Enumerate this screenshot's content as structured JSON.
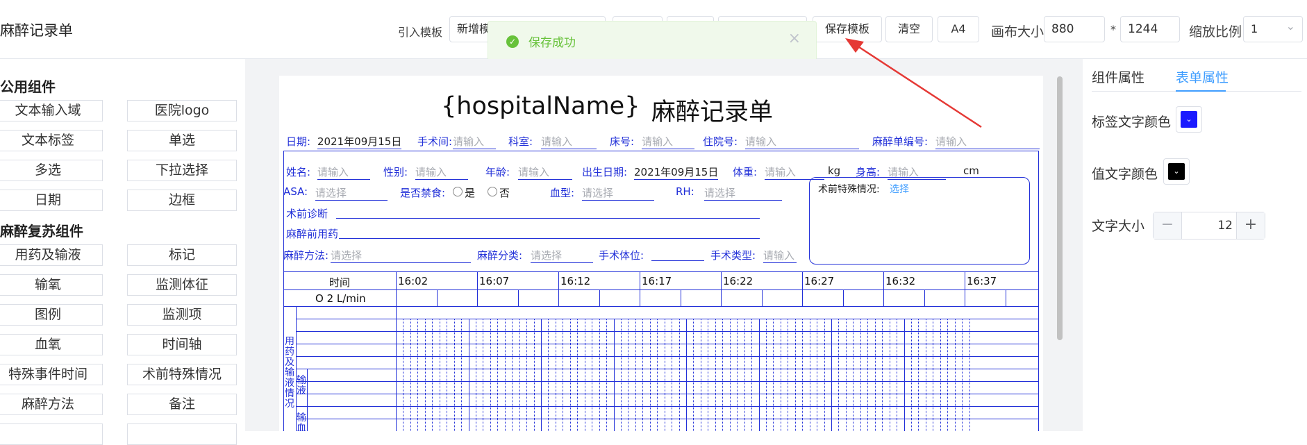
{
  "header": {
    "app_title": "麻醉记录单",
    "import_template_label": "引入模板",
    "template_select_value": "新增模",
    "save_template_label": "保存模板",
    "clear_label": "清空",
    "paper_size_label": "A4",
    "canvas_size_label": "画布大小",
    "canvas_width": "880",
    "canvas_times": "*",
    "canvas_height": "1244",
    "zoom_label": "缩放比例",
    "zoom_value": "1"
  },
  "toast": {
    "message": "保存成功",
    "close": "×",
    "check": "✓"
  },
  "left_panel": {
    "common_title": "公用组件",
    "common_items": [
      "文本输入域",
      "医院logo",
      "文本标签",
      "单选",
      "多选",
      "下拉选择",
      "日期",
      "边框"
    ],
    "anesthesia_title": "麻醉复苏组件",
    "anesthesia_items": [
      "用药及输液",
      "标记",
      "输氧",
      "监测体征",
      "图例",
      "监测项",
      "血氧",
      "时间轴",
      "特殊事件时间",
      "术前特殊情况",
      "麻醉方法",
      "备注"
    ]
  },
  "document": {
    "hospital_name": "{hospitalName}",
    "form_title": "麻醉记录单",
    "date_label": "日期:",
    "date_value": "2021年09月15日",
    "surgery_room_label": "手术间:",
    "dept_label": "科室:",
    "bed_label": "床号:",
    "admission_label": "住院号:",
    "record_no_label": "麻醉单编号:",
    "input_placeholder": "请输入",
    "select_placeholder": "请选择",
    "name_label": "姓名:",
    "sex_label": "性别:",
    "age_label": "年龄:",
    "birth_label": "出生日期:",
    "birth_value": "2021年09月15日",
    "weight_label": "体重:",
    "weight_unit": "kg",
    "height_label": "身高:",
    "height_unit": "cm",
    "asa_label": "ASA:",
    "fasting_label": "是否禁食:",
    "yes": "是",
    "no": "否",
    "blood_type_label": "血型:",
    "rh_label": "RH:",
    "preop_diag_label": "术前诊断",
    "preop_drug_label": "麻醉前用药",
    "method_label": "麻醉方法:",
    "class_label": "麻醉分类:",
    "position_label": "手术体位:",
    "surgery_type_label": "手术类型:",
    "special_label": "术前特殊情况:",
    "special_select": "选择",
    "time_label": "时间",
    "o2_label": "O 2 L/min",
    "times": [
      "16:02",
      "16:07",
      "16:12",
      "16:17",
      "16:22",
      "16:27",
      "16:32",
      "16:37"
    ],
    "side_group_text": "用药及输液情况",
    "infusion_text": "输液",
    "blood_text": "输血"
  },
  "right_panel": {
    "tab_component": "组件属性",
    "tab_form": "表单属性",
    "label_color_label": "标签文字颜色",
    "label_color": "#1a1aff",
    "value_color_label": "值文字颜色",
    "value_color": "#000000",
    "font_size_label": "文字大小",
    "font_size_value": "12",
    "minus": "−",
    "plus": "+",
    "chevron": "⌄"
  },
  "colors": {
    "accent": "#409eff",
    "form_blue": "#2230d8",
    "success": "#67c23a",
    "arrow": "#e53935"
  }
}
